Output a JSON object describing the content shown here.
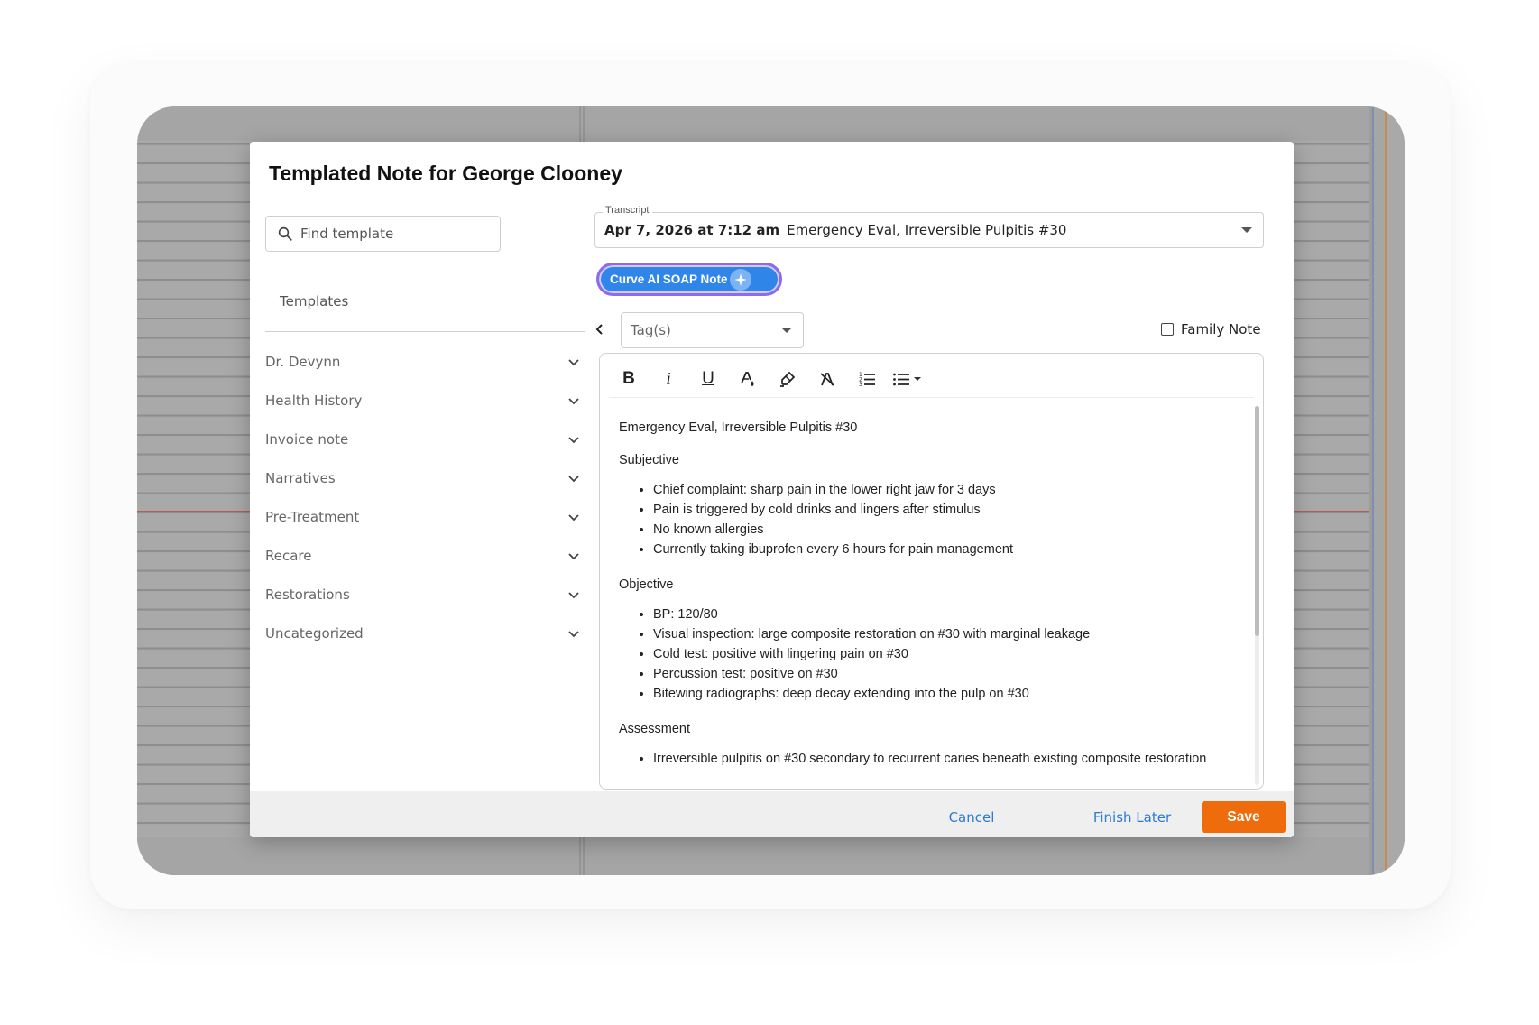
{
  "modal": {
    "title": "Templated Note for George Clooney"
  },
  "sidebar": {
    "search_placeholder": "Find template",
    "templates_label": "Templates",
    "categories": [
      {
        "label": "Dr. Devynn"
      },
      {
        "label": "Health History"
      },
      {
        "label": "Invoice note"
      },
      {
        "label": "Narratives"
      },
      {
        "label": "Pre-Treatment"
      },
      {
        "label": "Recare"
      },
      {
        "label": "Restorations"
      },
      {
        "label": "Uncategorized"
      }
    ]
  },
  "transcript": {
    "label": "Transcript",
    "date": "Apr 7, 2026 at 7:12 am",
    "title": "Emergency Eval, Irreversible Pulpitis #30"
  },
  "ai_button": {
    "label": "Curve AI SOAP Note"
  },
  "tags": {
    "placeholder": "Tag(s)"
  },
  "family_note": {
    "label": "Family Note",
    "checked": false
  },
  "toolbar": {
    "bold": "B",
    "italic": "i",
    "underline": "U"
  },
  "note": {
    "title": "Emergency Eval, Irreversible Pulpitis #30",
    "subjective_heading": "Subjective",
    "subjective_items": [
      "Chief complaint: sharp pain in the lower right jaw for 3 days",
      "Pain is triggered by cold drinks and lingers after stimulus",
      "No known allergies",
      "Currently taking ibuprofen every 6 hours for pain management"
    ],
    "objective_heading": "Objective",
    "objective_items": [
      "BP: 120/80",
      "Visual inspection: large composite restoration on #30 with marginal leakage",
      "Cold test: positive with lingering pain on #30",
      "Percussion test: positive on #30",
      "Bitewing radiographs: deep decay extending into the pulp on #30"
    ],
    "assessment_heading": "Assessment",
    "assessment_items": [
      "Irreversible pulpitis on #30 secondary to recurrent caries beneath existing composite restoration"
    ]
  },
  "footer": {
    "cancel": "Cancel",
    "finish_later": "Finish Later",
    "save": "Save"
  },
  "colors": {
    "accent_blue": "#2b7bd6",
    "save_orange": "#ef6c0c",
    "ai_button_blue": "#2f86e8"
  }
}
